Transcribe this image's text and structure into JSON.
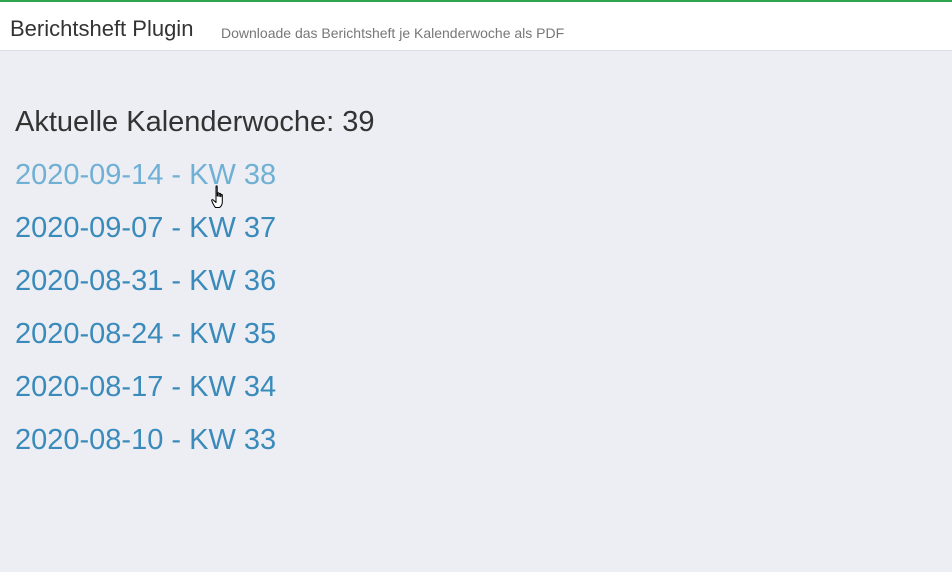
{
  "header": {
    "title": "Berichtsheft Plugin",
    "subtitle": "Downloade das Berichtsheft je Kalenderwoche als PDF"
  },
  "main": {
    "current_week_label": "Aktuelle Kalenderwoche: 39",
    "weeks": [
      {
        "label": "2020-09-14 - KW 38",
        "state": "hover"
      },
      {
        "label": "2020-09-07 - KW 37"
      },
      {
        "label": "2020-08-31 - KW 36"
      },
      {
        "label": "2020-08-24 - KW 35"
      },
      {
        "label": "2020-08-17 - KW 34"
      },
      {
        "label": "2020-08-10 - KW 33"
      }
    ]
  },
  "colors": {
    "accent": "#2ea44f",
    "link": "#3a8bbb",
    "link_hover": "#6fb0d4",
    "background": "#eceef3"
  },
  "icons": {
    "cursor": "hand-pointer-icon"
  }
}
